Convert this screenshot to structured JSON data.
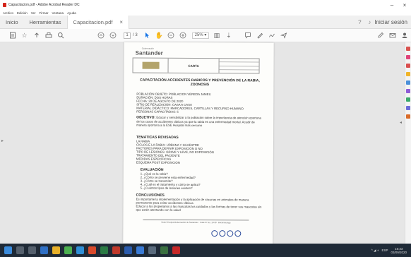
{
  "window": {
    "title": "Capacitacion.pdf - Adobe Acrobat Reader DC",
    "minimize": "–",
    "close": "×"
  },
  "menu": [
    "Archivo",
    "Edición",
    "Ver",
    "Firmar",
    "Ventana",
    "Ayuda"
  ],
  "tabs": {
    "home": "Inicio",
    "tools": "Herramientas",
    "document": "Capacitacion.pdf",
    "close": "×",
    "sign_in": "Iniciar sesión"
  },
  "toolbar": {
    "page_current": "1",
    "page_total": "/ 3",
    "zoom": "25%"
  },
  "document": {
    "logo_text": "Santander",
    "logo_sub": "Gobernación",
    "header_label": "CARTA",
    "title": "CAPACITACIÓN ACCIDENTES RABICOS Y PREVENCIÓN DE LA RABIA, ZOONOSIS",
    "info": [
      "POBLACIÓN OBJETO: POBLACION VEREDA JAMES",
      "DURACIÓN: DOS HORAS",
      "FECHA: 28 DE AGOSTO DE 2020",
      "SITIO DE REALIZACIÓN: CASA A CASA",
      "MATERIAL DIDÁCTICO: MARCADORES, CARTILLAS Y RECURSO HUMANO",
      "PERSONAS CAPACITADAS: 5"
    ],
    "objective_label": "OBJETIVO:",
    "objective": "Educar y sensibilizar a la población sobre la importancia de atención oportuna de los casos de accidentes rábicos ya que la rabia es una enfermedad mortal. Acudir de manera oportuna a la ESE Hospital más cercano",
    "topics_title": "TEMÁTICAS REVISADAS",
    "topics": [
      "LA RABIA",
      "CICLOS E LA RABIA: URBANA Y SILVESTRE",
      "FACTORES PARA DEFINIR EXPOSICIÓN O NO",
      "TIPO DE LESIONES: GRAVE Y LEVE, NO EXPOSICIÓN",
      "TRATAMIENTO DEL PACIENTE",
      "MEDIDAS ESPECÍFICAS",
      "ESQUEMA POST EXPOSICIÓN"
    ],
    "evaluation_title": "EVALUACIÓN",
    "evaluation": [
      "1.  ¿Qué es la rabia?",
      "2.  ¿Cómo se previene esta enfermedad?",
      "3.  ¿Cómo se transmite?",
      "4.  ¿Cuál es el tratamiento y cómo se aplica?",
      "5.  ¿Cuántos tipos de lesiones existen?"
    ],
    "conclusions_title": "CONCLUSIONES",
    "conclusions": [
      "Es importante la implementación y la aplicación de vacunas en animales de manera permanente para evitar accidentes rábicos",
      "Educar a los propietarios a las mascotas los cuidados y las formas de tener sus mascotas sin que estén atentando con la salud"
    ],
    "footer": "Sede Principal Gobernación de Santander · Calle 37 No. 10-30 · Bucaramanga"
  },
  "taskbar": {
    "language": "ESP",
    "time": "16:33",
    "date": "03/09/2020"
  }
}
